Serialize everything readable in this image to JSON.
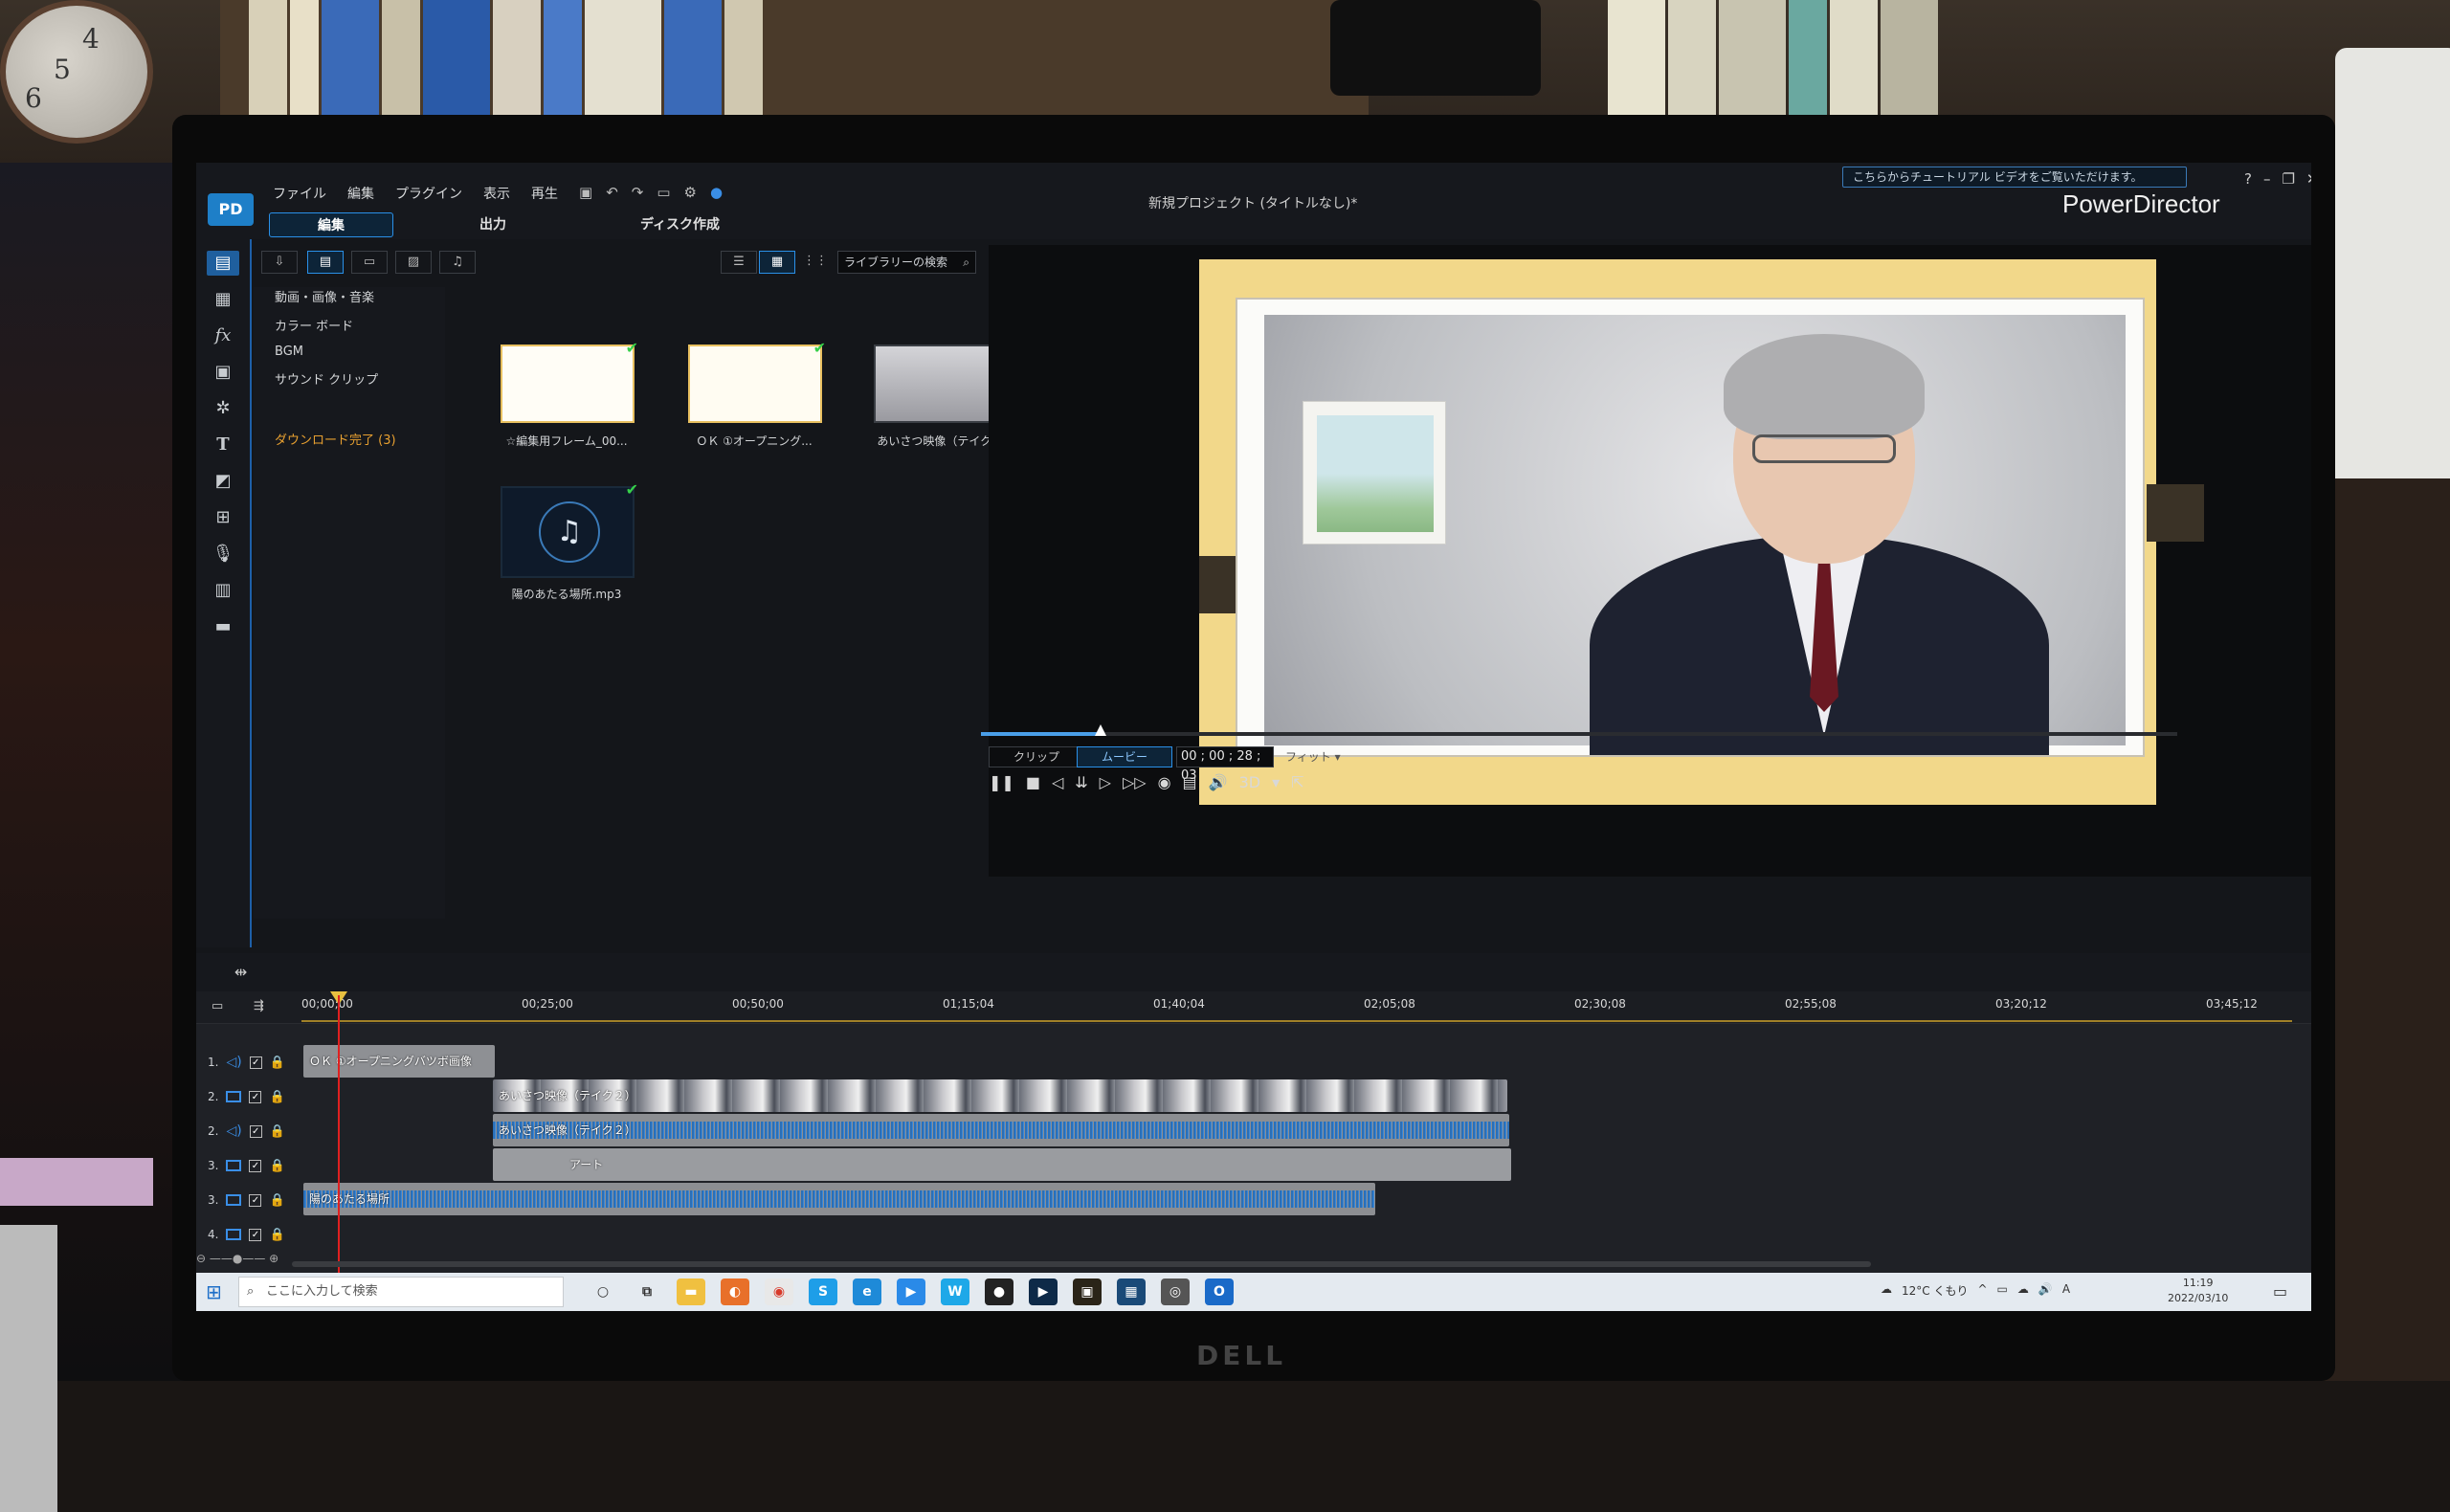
{
  "menu": [
    "ファイル",
    "編集",
    "プラグイン",
    "表示",
    "再生"
  ],
  "modes": [
    "編集",
    "出力",
    "ディスク作成"
  ],
  "project_title": "新規プロジェクト (タイトルなし)*",
  "tutorial_banner": "こちらからチュートリアル ビデオをご覧いただけます。",
  "brand": "PowerDirector",
  "library": {
    "search_placeholder": "ライブラリーの検索",
    "categories": [
      "動画・画像・音楽",
      "カラー ボード",
      "BGM",
      "サウンド クリップ"
    ],
    "download_complete": "ダウンロード完了 (3)",
    "media": [
      {
        "label": "☆編集用フレーム_00..."
      },
      {
        "label": "ＯＫ ①オープニング..."
      },
      {
        "label": "あいさつ映像（テイク..."
      },
      {
        "label": "陽のあたる場所.mp3"
      }
    ]
  },
  "preview": {
    "mode_clip": "クリップ",
    "mode_movie": "ムービー",
    "timecode": "00 ; 00 ; 28 ; 03",
    "fit": "フィット",
    "three_d": "3D",
    "progress": 0.1
  },
  "timeline": {
    "ticks": [
      "00;00;00",
      "00;25;00",
      "00;50;00",
      "01;15;04",
      "01;40;04",
      "02;05;08",
      "02;30;08",
      "02;55;08",
      "03;20;12",
      "03;45;12"
    ],
    "tracks": [
      "1.",
      "2.",
      "2.",
      "3.",
      "3.",
      "4."
    ],
    "clips": {
      "opening": "ＯＫ ①オープニングバツボ画像",
      "greeting_video": "あいさつ映像（テイク２）",
      "greeting_audio": "あいさつ映像（テイク２）",
      "art": "アート",
      "music": "陽のあたる場所"
    }
  },
  "taskbar": {
    "search": "ここに入力して検索",
    "weather": "12°C くもり",
    "ime": "A",
    "time": "11:19",
    "date": "2022/03/10"
  },
  "monitor_brand": "DELL"
}
